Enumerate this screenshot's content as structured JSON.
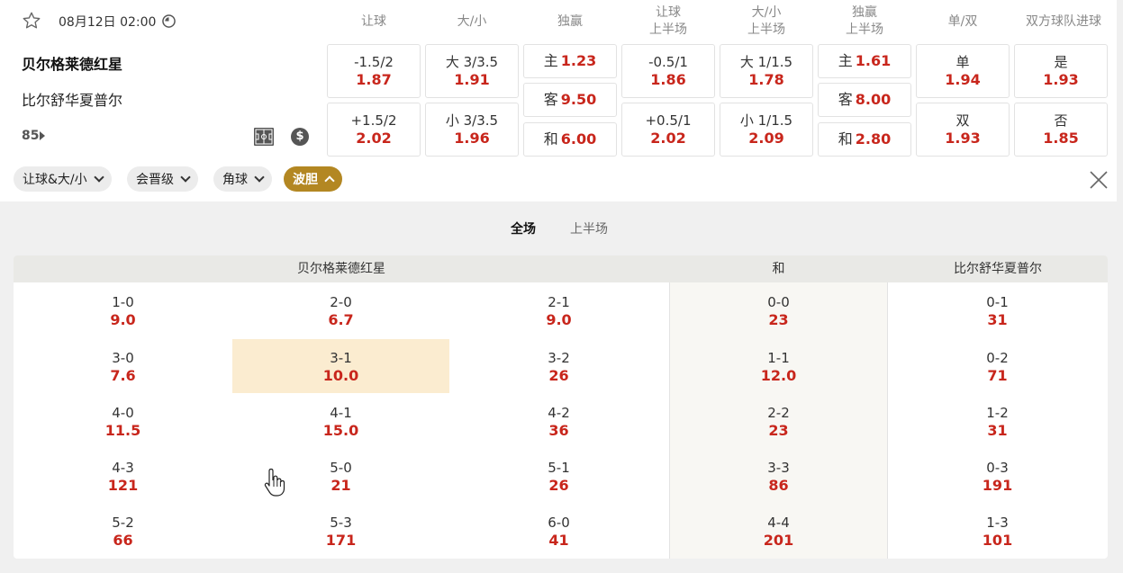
{
  "match": {
    "datetime": "08月12日 02:00",
    "home_team": "贝尔格莱德红星",
    "away_team": "比尔舒华夏普尔",
    "more_markets": "85"
  },
  "headers": {
    "handicap": [
      "让球"
    ],
    "total": [
      "大/小"
    ],
    "win": [
      "独赢"
    ],
    "handicap_half": [
      "让球",
      "上半场"
    ],
    "total_half": [
      "大/小",
      "上半场"
    ],
    "win_half": [
      "独赢",
      "上半场"
    ],
    "odd_even": [
      "单/双"
    ],
    "btts": [
      "双方球队进球"
    ]
  },
  "odds": {
    "handicap": [
      {
        "label": "-1.5/2",
        "value": "1.87"
      },
      {
        "label": "+1.5/2",
        "value": "2.02"
      }
    ],
    "total": [
      {
        "label": "大 3/3.5",
        "value": "1.91"
      },
      {
        "label": "小 3/3.5",
        "value": "1.96"
      }
    ],
    "win": [
      {
        "label": "主",
        "value": "1.23"
      },
      {
        "label": "客",
        "value": "9.50"
      },
      {
        "label": "和",
        "value": "6.00"
      }
    ],
    "handicap_half": [
      {
        "label": "-0.5/1",
        "value": "1.86"
      },
      {
        "label": "+0.5/1",
        "value": "2.02"
      }
    ],
    "total_half": [
      {
        "label": "大 1/1.5",
        "value": "1.78"
      },
      {
        "label": "小 1/1.5",
        "value": "2.09"
      }
    ],
    "win_half": [
      {
        "label": "主",
        "value": "1.61"
      },
      {
        "label": "客",
        "value": "8.00"
      },
      {
        "label": "和",
        "value": "2.80"
      }
    ],
    "odd_even": [
      {
        "label": "单",
        "value": "1.94"
      },
      {
        "label": "双",
        "value": "1.93"
      }
    ],
    "btts": [
      {
        "label": "是",
        "value": "1.93"
      },
      {
        "label": "否",
        "value": "1.85"
      }
    ]
  },
  "filters": [
    {
      "label": "让球&大/小",
      "active": false
    },
    {
      "label": "会晋级",
      "active": false
    },
    {
      "label": "角球",
      "active": false
    },
    {
      "label": "波胆",
      "active": true
    }
  ],
  "period_tabs": [
    {
      "label": "全场",
      "selected": true
    },
    {
      "label": "上半场",
      "selected": false
    }
  ],
  "correct_score": {
    "headers": {
      "home": "贝尔格莱德红星",
      "draw": "和",
      "away": "比尔舒华夏普尔"
    },
    "home": [
      [
        {
          "score": "1-0",
          "odds": "9.0"
        },
        {
          "score": "2-0",
          "odds": "6.7"
        },
        {
          "score": "2-1",
          "odds": "9.0"
        }
      ],
      [
        {
          "score": "3-0",
          "odds": "7.6"
        },
        {
          "score": "3-1",
          "odds": "10.0",
          "selected": true
        },
        {
          "score": "3-2",
          "odds": "26"
        }
      ],
      [
        {
          "score": "4-0",
          "odds": "11.5"
        },
        {
          "score": "4-1",
          "odds": "15.0"
        },
        {
          "score": "4-2",
          "odds": "36"
        }
      ],
      [
        {
          "score": "4-3",
          "odds": "121"
        },
        {
          "score": "5-0",
          "odds": "21"
        },
        {
          "score": "5-1",
          "odds": "26"
        }
      ],
      [
        {
          "score": "5-2",
          "odds": "66"
        },
        {
          "score": "5-3",
          "odds": "171"
        },
        {
          "score": "6-0",
          "odds": "41"
        }
      ]
    ],
    "draw": [
      {
        "score": "0-0",
        "odds": "23"
      },
      {
        "score": "1-1",
        "odds": "12.0"
      },
      {
        "score": "2-2",
        "odds": "23"
      },
      {
        "score": "3-3",
        "odds": "86"
      },
      {
        "score": "4-4",
        "odds": "201"
      }
    ],
    "away": [
      {
        "score": "0-1",
        "odds": "31"
      },
      {
        "score": "0-2",
        "odds": "71"
      },
      {
        "score": "1-2",
        "odds": "31"
      },
      {
        "score": "0-3",
        "odds": "191"
      },
      {
        "score": "1-3",
        "odds": "101"
      }
    ]
  },
  "colors": {
    "odds_red": "#c8261c",
    "active_chip": "#b38722",
    "selected_cell": "#fbecd0"
  },
  "icons": {
    "favorite": "star-icon",
    "live": "live-clock-icon",
    "pitch": "pitch-icon",
    "stats": "dollar-icon",
    "close": "close-icon"
  }
}
